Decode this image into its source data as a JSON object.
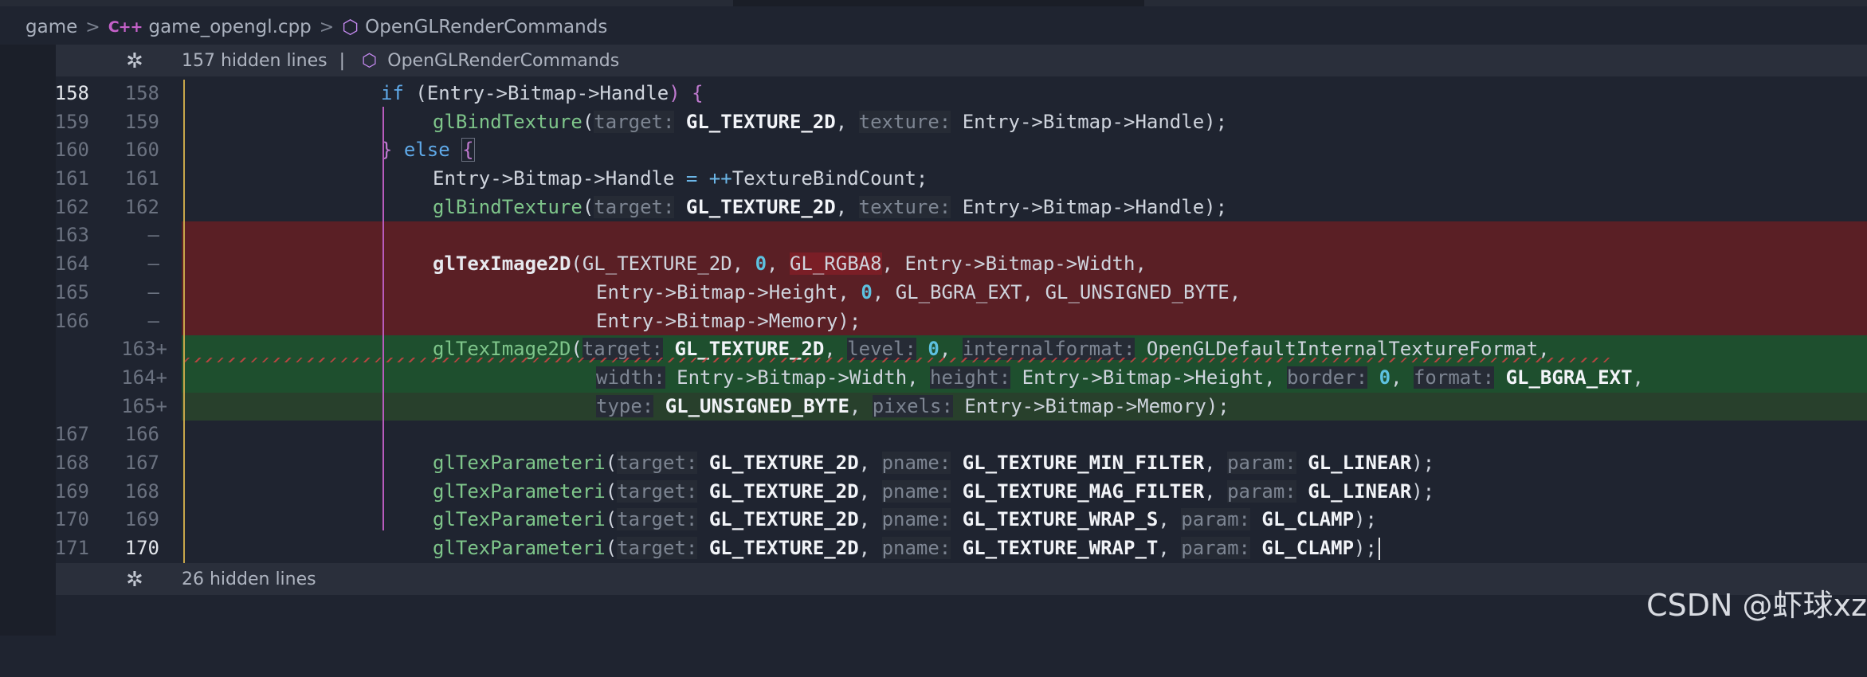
{
  "breadcrumb": {
    "root": "game",
    "file_icon": "cpp-file-icon",
    "file_icon_text": "C++",
    "file": "game_opengl.cpp",
    "symbol_icon": "cube-icon",
    "symbol": "OpenGLRenderCommands"
  },
  "hidden_top": {
    "count_text": "157 hidden lines",
    "divider": "|",
    "symbol": "OpenGLRenderCommands"
  },
  "hidden_bottom": {
    "count_text": "26 hidden lines"
  },
  "lines": [
    {
      "old": "158",
      "new": "158"
    },
    {
      "old": "159",
      "new": "159"
    },
    {
      "old": "160",
      "new": "160"
    },
    {
      "old": "161",
      "new": "161"
    },
    {
      "old": "162",
      "new": "162"
    },
    {
      "old": "163",
      "new": "—"
    },
    {
      "old": "164",
      "new": "—"
    },
    {
      "old": "165",
      "new": "—"
    },
    {
      "old": "166",
      "new": "—"
    },
    {
      "old": "",
      "new": "163+"
    },
    {
      "old": "",
      "new": "164+"
    },
    {
      "old": "",
      "new": "165+"
    },
    {
      "old": "167",
      "new": "166"
    },
    {
      "old": "168",
      "new": "167"
    },
    {
      "old": "169",
      "new": "168"
    },
    {
      "old": "170",
      "new": "169"
    },
    {
      "old": "171",
      "new": "170"
    }
  ],
  "code": {
    "if": "if",
    "paren_open": "(",
    "entry_bitmap_handle": "Entry->Bitmap->Handle",
    "paren_close_brace": ") {",
    "glBindTexture": "glBindTexture",
    "target_hint": "target:",
    "gl_texture_2d": "GL_TEXTURE_2D",
    "texture_hint": "texture:",
    "close_paren_semi": ");",
    "close_brace": "}",
    "else": "else",
    "open_brace": "{",
    "handle_assign": "Entry->Bitmap->Handle",
    "eq": " = ",
    "inc": "++",
    "texture_bind_count": "TextureBindCount;",
    "glTexImage2D": "glTexImage2D",
    "del_line1_a": "GL_TEXTURE_2D, ",
    "zero": "0",
    "comma_space": ", ",
    "gl_rgba8": "GL_RGBA8",
    "del_line1_b": "Entry->Bitmap->Width,",
    "del_line2_a": "Entry->Bitmap->Height, ",
    "del_line2_b": "GL_BGRA_EXT",
    "del_line2_c": "GL_UNSIGNED_BYTE,",
    "del_line3": "Entry->Bitmap->Memory);",
    "level_hint": "level:",
    "internalformat_hint": "internalformat:",
    "internal_value": "OpenGLDefaultInternalTextureFormat",
    "comma": ",",
    "width_hint": "width:",
    "width_value": "Entry->Bitmap->Width",
    "height_hint": "height:",
    "height_value": "Entry->Bitmap->Height",
    "border_hint": "border:",
    "format_hint": "format:",
    "bgra_ext": "GL_BGRA_EXT",
    "type_hint": "type:",
    "unsigned_byte": "GL_UNSIGNED_BYTE",
    "pixels_hint": "pixels:",
    "memory_value": "Entry->Bitmap->Memory",
    "glTexParameteri": "glTexParameteri",
    "pname_hint": "pname:",
    "param_hint": "param:",
    "min_filter": "GL_TEXTURE_MIN_FILTER",
    "mag_filter": "GL_TEXTURE_MAG_FILTER",
    "wrap_s": "GL_TEXTURE_WRAP_S",
    "wrap_t": "GL_TEXTURE_WRAP_T",
    "gl_linear": "GL_LINEAR",
    "gl_clamp": "GL_CLAMP"
  },
  "watermark": "CSDN @虾球xz",
  "colors": {
    "deleted_bg": "#5a1f25",
    "added_bg": "#1e4f2e",
    "keyword": "#5fa9e8",
    "function": "#7ec58a",
    "hint": "#7d8592"
  }
}
